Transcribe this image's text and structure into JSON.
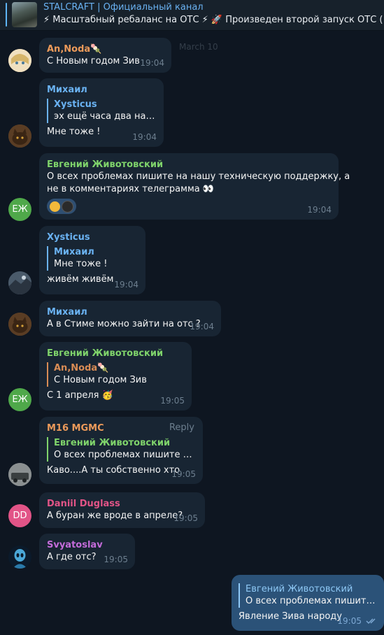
{
  "pinned": {
    "title": "STALCRAFT | Официальный канал",
    "text": "⚡ Масштабный ребаланс на ОТС ⚡ 🚀 Произведен второй запуск ОТС (от..."
  },
  "date_badge": "March 10",
  "colors": {
    "background": "#0e1621",
    "incoming_bubble": "#182533",
    "outgoing_bubble": "#2b5278",
    "name_orange": "#ec9a5a",
    "name_blue": "#6ab2f2",
    "name_green": "#7fd36b",
    "name_pink": "#e25487",
    "name_purple": "#c46cda",
    "reply_orange": "#d98c55"
  },
  "messages": [
    {
      "author": "An,Noda🍡",
      "text": "С Новым годом Зив",
      "time": "19:04"
    },
    {
      "author": "Михаил",
      "reply_author": "Xysticus",
      "reply_text": "эх ещё часа два на ра...",
      "text": "Мне тоже !",
      "time": "19:04"
    },
    {
      "author": "Евгений Животовский",
      "text_line1": "О всех проблемах пишите на нашу техническую поддержку, а",
      "text_line2": "не в комментариях телеграмма 👀",
      "time": "19:04",
      "avatar_initials": "ЕЖ"
    },
    {
      "author": "Xysticus",
      "reply_author": "Михаил",
      "reply_text": "Мне тоже !",
      "text": "живём живём",
      "time": "19:04"
    },
    {
      "author": "Михаил",
      "text": "А в Стиме можно зайти на отс ?",
      "time": "19:04"
    },
    {
      "author": "Евгений Животовский",
      "reply_author": "An,Noda🍡",
      "reply_text": "С Новым годом Зив",
      "text": "С 1 апреля 🥳",
      "time": "19:05",
      "avatar_initials": "ЕЖ"
    },
    {
      "author": "M16 MGMC",
      "reply_label": "Reply",
      "reply_author": "Евгений Животовский",
      "reply_text": "О всех проблемах пишите на ...",
      "text": "Каво....А ты собственно хто",
      "time": "19:05"
    },
    {
      "author": "Daniil Duglass",
      "text": "А буран же вроде в апреле?",
      "time": "19:05",
      "avatar_initials": "DD"
    },
    {
      "author": "Svyatoslav",
      "text": "А где отс?",
      "time": "19:05"
    }
  ],
  "outgoing": {
    "reply_author": "Евгений Животовский",
    "reply_text": "О всех проблемах пишите н...",
    "text": "Явление Зива народу",
    "time": "19:05",
    "status_icon": "double-check-icon"
  }
}
